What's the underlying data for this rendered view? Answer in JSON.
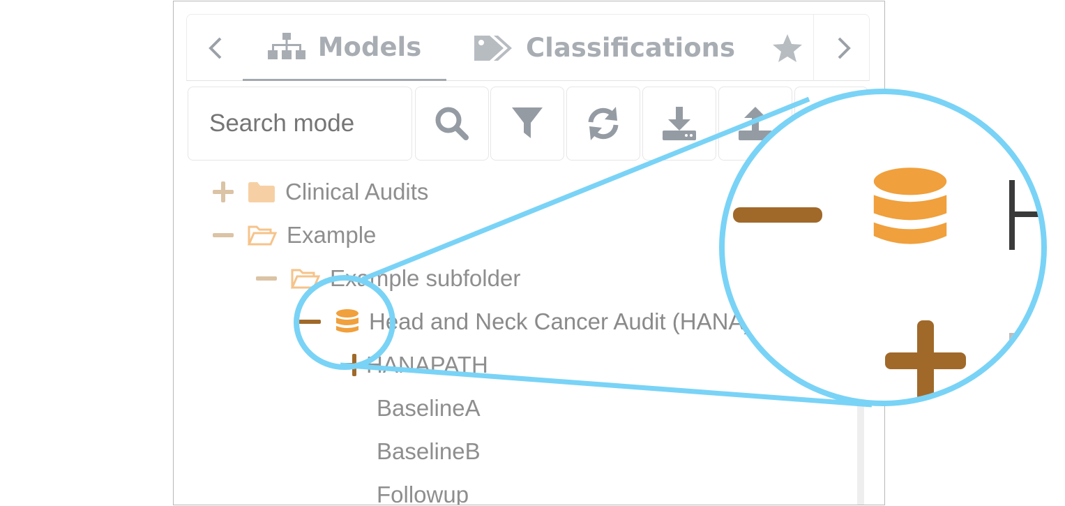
{
  "tabs": {
    "items": [
      {
        "label": "Models",
        "icon": "sitemap-icon",
        "active": true
      },
      {
        "label": "Classifications",
        "icon": "tags-icon",
        "active": false
      },
      {
        "label": "",
        "icon": "star-icon",
        "active": false
      }
    ],
    "prev_icon": "chevron-left-icon",
    "next_icon": "chevron-right-icon"
  },
  "toolbar": {
    "search_placeholder": "Search mode",
    "buttons": [
      "search-icon",
      "filter-icon",
      "refresh-icon",
      "download-icon",
      "upload-icon"
    ]
  },
  "tree": [
    {
      "label": "Clinical Audits",
      "toggle": "+",
      "icon": "folder-icon"
    },
    {
      "label": "Example",
      "toggle": "−",
      "icon": "folder-open-icon"
    },
    {
      "label": "Example subfolder",
      "toggle": "−",
      "icon": "folder-open-icon"
    },
    {
      "label": "Head and Neck Cancer Audit (HANA)",
      "toggle": "−",
      "icon": "database-icon"
    },
    {
      "label": "HANAPATH",
      "toggle": "+",
      "icon": ""
    },
    {
      "label": "BaselineA",
      "toggle": "",
      "icon": ""
    },
    {
      "label": "BaselineB",
      "toggle": "",
      "icon": ""
    },
    {
      "label": "Followup",
      "toggle": "",
      "icon": ""
    }
  ],
  "colors": {
    "accent": "#79d3f6",
    "folder": "#f6d0a4",
    "toggle_light": "#dbc3a5",
    "toggle_dark": "#a0692a",
    "database": "#f0a03c",
    "icon_gray": "#949ba3"
  }
}
